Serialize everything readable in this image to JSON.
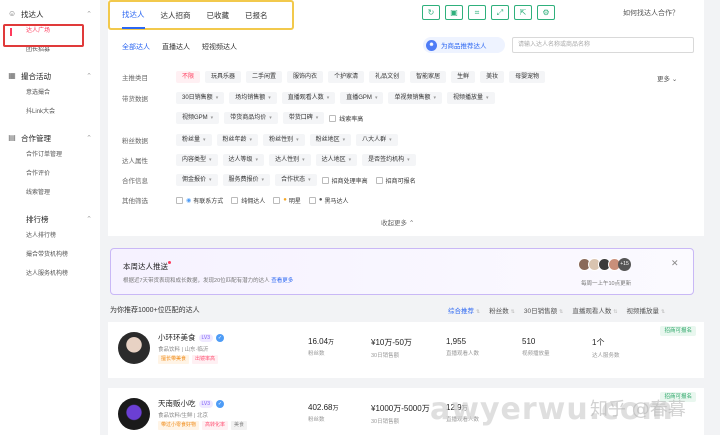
{
  "sidebar": {
    "groups": [
      {
        "label": "找达人",
        "icon": "user-search-icon",
        "items": [
          "达人广场",
          "团长招募"
        ]
      },
      {
        "label": "撮合活动",
        "icon": "grid-icon",
        "items": [
          "意选撮合",
          "抖Link大会"
        ]
      },
      {
        "label": "合作管理",
        "icon": "document-icon",
        "items": [
          "合作订单管理",
          "合作评价",
          "线索管理"
        ]
      },
      {
        "label": "排行榜",
        "icon": "",
        "items": [
          "达人排行榜",
          "撮合带货机构榜",
          "达人服务机构榜"
        ]
      }
    ]
  },
  "top_tabs": [
    "找达人",
    "达人招商",
    "已收藏",
    "已报名"
  ],
  "help_text": "如何找达人合作？",
  "sub_tabs": [
    "全部达人",
    "直播达人",
    "短视频达人"
  ],
  "recommend_button": "为商品推荐达人",
  "search_placeholder": "请输入达人名称或商品名称",
  "filters": {
    "main_category": {
      "label": "主推类目",
      "options": [
        "不限",
        "玩具乐器",
        "二手闲置",
        "服饰内衣",
        "个护家清",
        "礼品文创",
        "智能家居",
        "生鲜",
        "美妆",
        "母婴宠物"
      ]
    },
    "goods_data": {
      "label": "带货数据",
      "row1": [
        "30日销售额",
        "场均销售额",
        "直播观看人数",
        "直播GPM",
        "单视频销售额",
        "视频播放量"
      ],
      "row2": [
        "视频GPM",
        "带货商品均价",
        "带货口碑"
      ],
      "checkbox": "线索率高"
    },
    "fans_data": {
      "label": "粉丝数据",
      "options": [
        "粉丝量",
        "粉丝年龄",
        "粉丝性别",
        "粉丝地区",
        "八大人群"
      ]
    },
    "talent_attr": {
      "label": "达人属性",
      "options": [
        "内容类型",
        "达人等级",
        "达人性别",
        "达人地区",
        "是否签约机构"
      ]
    },
    "coop_info": {
      "label": "合作信息",
      "options": [
        "佣金报价",
        "服务费报价",
        "合作状态"
      ],
      "checks": [
        "招商处理率高",
        "招商可报名"
      ]
    },
    "other": {
      "label": "其他筛选",
      "checks": [
        "有联系方式",
        "纯佣达人",
        "明星",
        "黑马达人"
      ]
    }
  },
  "more_label": "更多",
  "collapse_label": "收起更多",
  "push": {
    "title": "本周达人推送",
    "desc": "根据近7天带货表现和成长数据，发现20位匹配有潜力的达人",
    "link": "查看更多",
    "avatar_count": "+15",
    "update_text": "每周一上午10点更新"
  },
  "results_text": "为你推荐1000+位匹配的达人",
  "sort_options": [
    "综合推荐",
    "粉丝数",
    "30日销售额",
    "直播观看人数",
    "视频播放量"
  ],
  "creators": [
    {
      "name": "小环环美食",
      "level": "LV3",
      "meta": "食品饮料  |  山东·临沂",
      "tags": [
        {
          "text": "擅长带美食",
          "kind": "o"
        },
        {
          "text": "出镜率高",
          "kind": "p"
        }
      ],
      "badge": "招商可报名",
      "metrics": [
        {
          "v": "16.04",
          "u": "万",
          "l": "粉丝数"
        },
        {
          "v": "¥10万-50万",
          "u": "",
          "l": "30日销售额"
        },
        {
          "v": "1,955",
          "u": "",
          "l": "直播观看人数"
        },
        {
          "v": "510",
          "u": "",
          "l": "视频播放量"
        },
        {
          "v": "1个",
          "u": "",
          "l": "达人服务数"
        }
      ]
    },
    {
      "name": "天南贩小吃",
      "level": "LV3",
      "meta": "食品饮料/生鲜  |  北京",
      "tags": [
        {
          "text": "带过小零食好物",
          "kind": "o"
        },
        {
          "text": "高转化率",
          "kind": "p"
        },
        {
          "text": "美食",
          "kind": "g"
        }
      ],
      "badge": "招商可报名",
      "metrics": [
        {
          "v": "402.68",
          "u": "万",
          "l": "粉丝数"
        },
        {
          "v": "¥1000万-5000万",
          "u": "",
          "l": "30日销售额"
        },
        {
          "v": "12.9",
          "u": "万",
          "l": "直播观看人数"
        }
      ]
    }
  ],
  "watermark": "awyerwu.com",
  "watermark2": "知乎 @春暮"
}
